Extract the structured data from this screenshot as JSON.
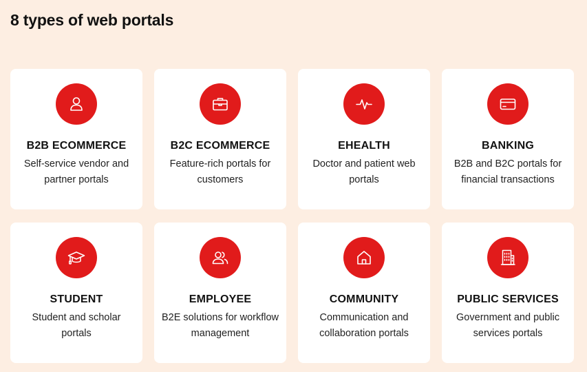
{
  "page": {
    "title": "8 types of web portals"
  },
  "colors": {
    "background": "#fdeee2",
    "accent": "#e11b1b",
    "card": "#ffffff"
  },
  "cards": [
    {
      "title": "B2B ECOMMERCE",
      "description": "Self-service vendor and partner portals",
      "icon": "user-icon"
    },
    {
      "title": "B2C ECOMMERCE",
      "description": "Feature-rich portals for customers",
      "icon": "briefcase-icon"
    },
    {
      "title": "EHEALTH",
      "description": "Doctor and patient web portals",
      "icon": "heartbeat-icon"
    },
    {
      "title": "BANKING",
      "description": "B2B and B2C portals for financial transactions",
      "icon": "credit-card-icon"
    },
    {
      "title": "STUDENT",
      "description": "Student and scholar portals",
      "icon": "graduation-cap-icon"
    },
    {
      "title": "EMPLOYEE",
      "description": "B2E solutions for workflow management",
      "icon": "users-icon"
    },
    {
      "title": "COMMUNITY",
      "description": "Communication and collaboration portals",
      "icon": "home-icon"
    },
    {
      "title": "PUBLIC SERVICES",
      "description": "Government and public services portals",
      "icon": "building-icon"
    }
  ]
}
